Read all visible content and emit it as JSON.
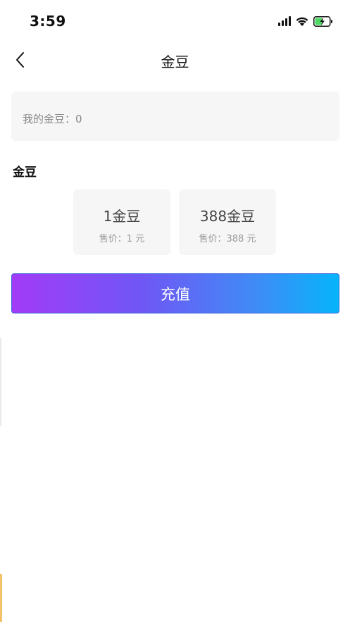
{
  "status_bar": {
    "time": "3:59",
    "icons": [
      "signal-icon",
      "wifi-icon",
      "battery-charging-icon"
    ],
    "battery_color": "#4cd964"
  },
  "nav": {
    "back_icon": "chevron-left-icon",
    "title": "金豆"
  },
  "balance": {
    "label": "我的金豆：0"
  },
  "section": {
    "title": "金豆"
  },
  "packages": [
    {
      "amount": "1金豆",
      "price": "售价：1 元"
    },
    {
      "amount": "388金豆",
      "price": "售价：388 元"
    }
  ],
  "recharge": {
    "label": "充值",
    "gradient": [
      "#a23bf7",
      "#06b4fb"
    ]
  }
}
